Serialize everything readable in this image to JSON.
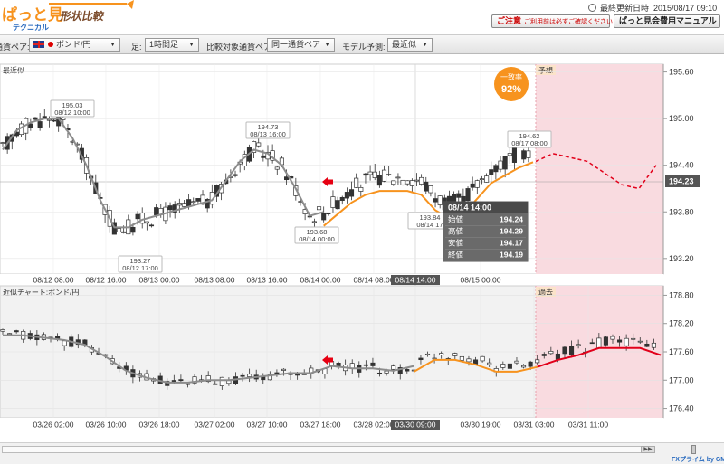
{
  "header": {
    "logo_text": "ぱっと見",
    "logo_sub": "テクニカル",
    "logo_badge": "形状比較",
    "updated_label": "最終更新日時",
    "updated_value": "2015/08/17 09:10",
    "caution_label": "ご注意",
    "caution_sub": "ご利用前は必ずご確認ください",
    "manual_label": "ぱっと見会費用マニュアル"
  },
  "toolbar": {
    "pair_label": "通貨ペア:",
    "pair_value": "ポンド/円",
    "period_label": "足:",
    "period_value": "1時間足",
    "compare_label": "比較対象通貨ペア:",
    "compare_value": "同一通貨ペア",
    "model_label": "モデル予測:",
    "model_value": "最近似"
  },
  "top_chart": {
    "panel_label": "最近似",
    "forecast_label": "予想",
    "match_label": "一致率",
    "match_value": "92%",
    "y_ticks": [
      "195.60",
      "195.00",
      "194.40",
      "193.80",
      "193.20"
    ],
    "current_price": "194.23",
    "x_ticks": [
      "08/12 08:00",
      "08/12 16:00",
      "08/13 00:00",
      "08/13 08:00",
      "08/13 16:00",
      "08/14 00:00",
      "08/14 08:00",
      "08/14 14:00",
      "08/15 00:00"
    ],
    "annotations": [
      {
        "price": "195.03",
        "time": "08/12 10:00"
      },
      {
        "price": "193.27",
        "time": "08/12 17:00"
      },
      {
        "price": "194.73",
        "time": "08/13 16:00"
      },
      {
        "price": "193.68",
        "time": "08/14 00:00"
      },
      {
        "price": "193.84",
        "time": "08/14 17"
      },
      {
        "price": "194.62",
        "time": "08/17 08:00"
      }
    ],
    "tooltip": {
      "title": "08/14 14:00",
      "rows": [
        {
          "label": "始値",
          "value": "194.24"
        },
        {
          "label": "高値",
          "value": "194.29"
        },
        {
          "label": "安値",
          "value": "194.17"
        },
        {
          "label": "終値",
          "value": "194.19"
        }
      ]
    }
  },
  "bottom_chart": {
    "panel_label": "近似チャート:ポンド/円",
    "past_label": "過去",
    "y_ticks": [
      "178.80",
      "178.20",
      "177.60",
      "177.00",
      "176.40"
    ],
    "x_ticks": [
      "03/26 02:00",
      "03/26 10:00",
      "03/26 18:00",
      "03/27 02:00",
      "03/27 10:00",
      "03/27 18:00",
      "03/28 02:00",
      "03/30 09:00",
      "03/30 19:00",
      "03/31 03:00",
      "03/31 11:00"
    ]
  },
  "footer": {
    "credit": "FXプライム by GMO"
  },
  "colors": {
    "bull": "#ffffff",
    "bear": "#333333",
    "ma": "#8c8c8c",
    "orange": "#f7931e",
    "forecast": "#e2001a",
    "forecast_zone": "#f9dbe0",
    "badge": "#f7931e"
  },
  "chart_data": [
    {
      "type": "line",
      "title": "最近似",
      "x": [
        "08/12 02:00",
        "08/12 04:00",
        "08/12 06:00",
        "08/12 08:00",
        "08/12 10:00",
        "08/12 12:00",
        "08/12 14:00",
        "08/12 16:00",
        "08/12 18:00",
        "08/12 20:00",
        "08/12 22:00",
        "08/13 00:00",
        "08/13 02:00",
        "08/13 04:00",
        "08/13 06:00",
        "08/13 08:00",
        "08/13 10:00",
        "08/13 12:00",
        "08/13 14:00",
        "08/13 16:00",
        "08/13 18:00",
        "08/13 20:00",
        "08/13 22:00",
        "08/14 00:00",
        "08/14 02:00",
        "08/14 04:00",
        "08/14 06:00",
        "08/14 08:00",
        "08/14 10:00",
        "08/14 12:00",
        "08/14 14:00",
        "08/14 16:00",
        "08/14 18:00",
        "08/14 20:00",
        "08/14 22:00",
        "08/15 00:00",
        "08/15 02:00",
        "08/15 04:00",
        "08/17 08:00"
      ],
      "series": [
        {
          "name": "",
          "values": [
            194.6,
            194.85,
            194.95,
            195.0,
            195.0,
            194.75,
            194.4,
            193.95,
            193.6,
            193.6,
            193.7,
            193.75,
            193.8,
            193.85,
            193.9,
            193.95,
            194.2,
            194.45,
            194.6,
            194.55,
            194.4,
            194.1,
            193.75,
            193.8,
            193.95,
            194.1,
            194.2,
            194.25,
            194.25,
            194.25,
            194.2,
            194.0,
            193.9,
            193.95,
            194.15,
            194.35,
            194.45,
            194.55,
            194.62
          ]
        }
      ],
      "forecast": [
        194.45,
        194.55,
        194.5,
        194.45,
        194.3,
        194.15,
        194.1,
        194.4
      ],
      "ylim": [
        193.0,
        195.7
      ]
    },
    {
      "type": "line",
      "title": "近似チャート:ポンド/円",
      "x": [
        "03/26 02:00",
        "03/26 04:00",
        "03/26 06:00",
        "03/26 08:00",
        "03/26 10:00",
        "03/26 12:00",
        "03/26 14:00",
        "03/26 16:00",
        "03/26 18:00",
        "03/26 20:00",
        "03/26 22:00",
        "03/27 00:00",
        "03/27 02:00",
        "03/27 04:00",
        "03/27 06:00",
        "03/27 08:00",
        "03/27 10:00",
        "03/27 12:00",
        "03/27 14:00",
        "03/27 16:00",
        "03/27 18:00",
        "03/27 20:00",
        "03/28 02:00",
        "03/30 01:00",
        "03/30 05:00",
        "03/30 09:00",
        "03/30 13:00",
        "03/30 17:00",
        "03/30 19:00",
        "03/30 23:00",
        "03/31 03:00",
        "03/31 07:00",
        "03/31 11:00"
      ],
      "series": [
        {
          "name": "",
          "values": [
            177.95,
            177.95,
            177.9,
            177.85,
            177.75,
            177.5,
            177.2,
            177.05,
            176.95,
            176.95,
            177.0,
            177.0,
            177.05,
            177.1,
            177.15,
            177.15,
            177.3,
            177.25,
            177.25,
            177.2,
            177.3,
            177.55,
            177.55,
            177.45,
            177.3,
            177.3,
            177.4,
            177.55,
            177.65,
            177.8,
            177.8,
            177.8,
            177.65
          ]
        }
      ],
      "ylim": [
        176.2,
        179.0
      ]
    }
  ]
}
